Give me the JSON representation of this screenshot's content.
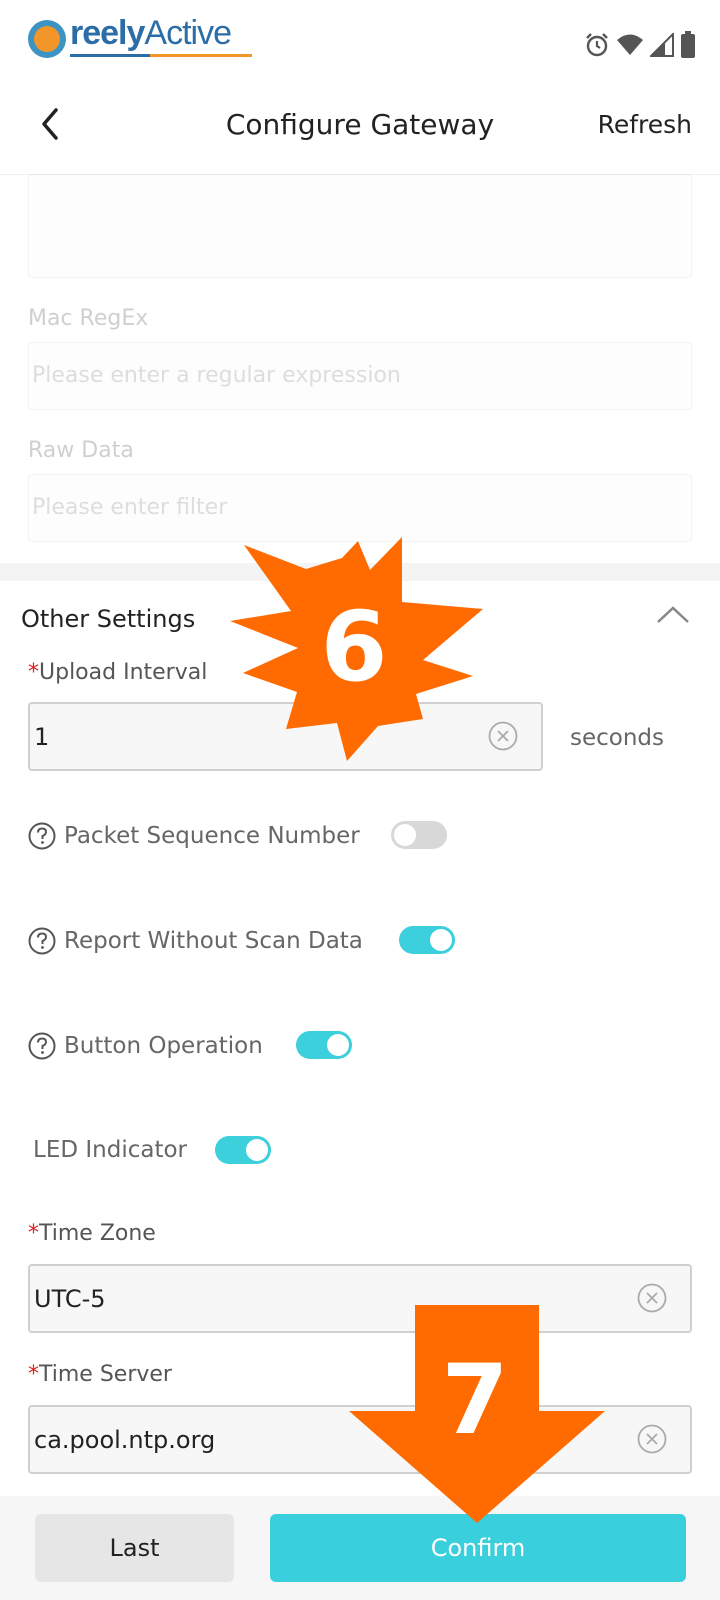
{
  "status_bar": {
    "brand_reely": "reely",
    "brand_active": "Active",
    "icons": [
      "alarm-icon",
      "wifi-icon",
      "cellular-signal-icon",
      "battery-icon"
    ]
  },
  "header": {
    "title": "Configure Gateway",
    "refresh_label": "Refresh"
  },
  "filters": {
    "mac_regex_label": "Mac RegEx",
    "mac_regex_placeholder": "Please enter a regular expression",
    "raw_data_label": "Raw Data",
    "raw_data_placeholder": "Please enter filter"
  },
  "other_settings": {
    "title": "Other Settings",
    "upload_interval_label": "Upload Interval",
    "upload_interval_value": "1",
    "upload_interval_unit": "seconds",
    "packet_sequence_label": "Packet Sequence Number",
    "packet_sequence_on": false,
    "report_without_scan_label": "Report Without Scan Data",
    "report_without_scan_on": true,
    "button_operation_label": "Button Operation",
    "button_operation_on": true,
    "led_indicator_label": "LED Indicator",
    "led_indicator_on": true,
    "time_zone_label": "Time Zone",
    "time_zone_value": "UTC-5",
    "time_server_label": "Time Server",
    "time_server_value": "ca.pool.ntp.org",
    "required_mark": "*"
  },
  "footer": {
    "last_label": "Last",
    "confirm_label": "Confirm"
  },
  "annotations": {
    "step_6": "6",
    "step_7": "7"
  },
  "colors": {
    "accent": "#39cfdc",
    "annotation": "#ff6b00",
    "required": "#e02020"
  }
}
